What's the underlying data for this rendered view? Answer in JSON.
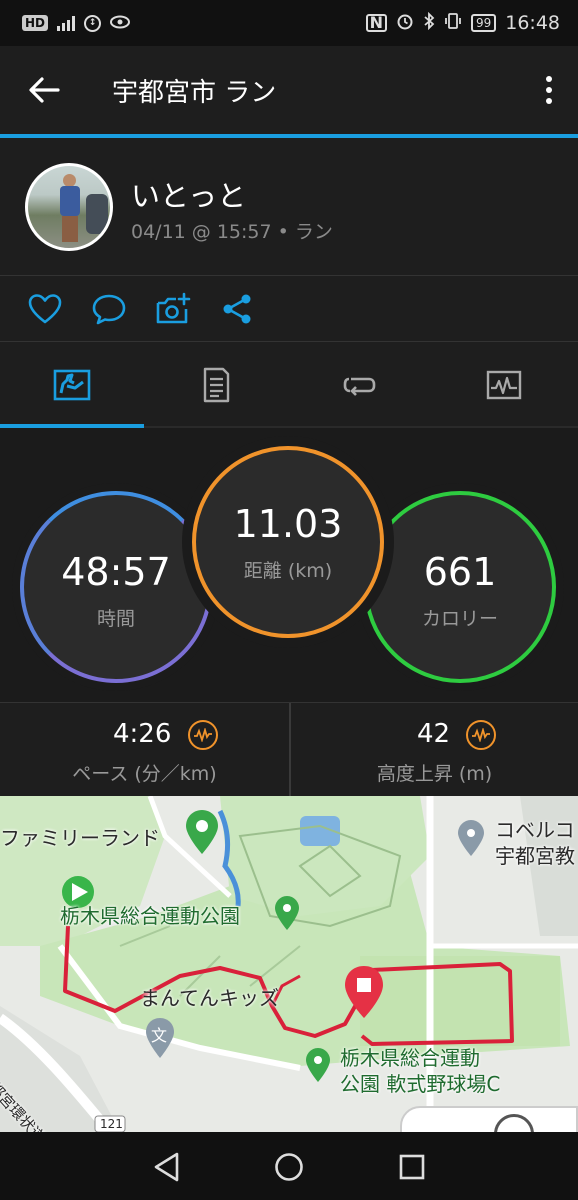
{
  "status_bar": {
    "left_icons": [
      "hd-icon",
      "4g-signal-icon",
      "data-icon",
      "eye-icon"
    ],
    "right_icons": [
      "nfc-icon",
      "alarm-icon",
      "bluetooth-icon",
      "vibrate-icon"
    ],
    "battery": "99",
    "time": "16:48"
  },
  "app_bar": {
    "title": "宇都宮市 ラン"
  },
  "profile": {
    "name": "いとっと",
    "meta": "04/11 @ 15:57 • ラン"
  },
  "actions": [
    "like-icon",
    "comment-icon",
    "add-photo-icon",
    "share-icon"
  ],
  "tabs": [
    {
      "name": "overview-tab",
      "icon": "overview-icon",
      "active": true
    },
    {
      "name": "details-tab",
      "icon": "document-icon",
      "active": false
    },
    {
      "name": "laps-tab",
      "icon": "laps-icon",
      "active": false
    },
    {
      "name": "charts-tab",
      "icon": "chart-icon",
      "active": false
    }
  ],
  "stats": {
    "time": {
      "value": "48:57",
      "label": "時間"
    },
    "distance": {
      "value": "11.03",
      "label": "距離 (km)"
    },
    "calories": {
      "value": "661",
      "label": "カロリー"
    }
  },
  "metrics": {
    "pace": {
      "value": "4:26",
      "label": "ペース (分／km)"
    },
    "ascent": {
      "value": "42",
      "label": "高度上昇 (m)"
    }
  },
  "map": {
    "labels": {
      "family_land": "ファミリーランド",
      "park": "栃木県総合運動公園",
      "kids": "まんてんキッズ",
      "softball_line1": "栃木県総合運動",
      "softball_line2": "公園 軟式野球場C",
      "kobelco_line1": "コベルコ",
      "kobelco_line2": "宇都宮教",
      "ring_road": "宇都宮環状道路",
      "route_number": "121",
      "school_symbol": "文"
    }
  },
  "colors": {
    "accent": "#1a9ee0",
    "time_ring": "#7b6fd4",
    "distance_ring": "#f0932b",
    "calories_ring": "#2ecc40",
    "route": "#d9213a"
  }
}
